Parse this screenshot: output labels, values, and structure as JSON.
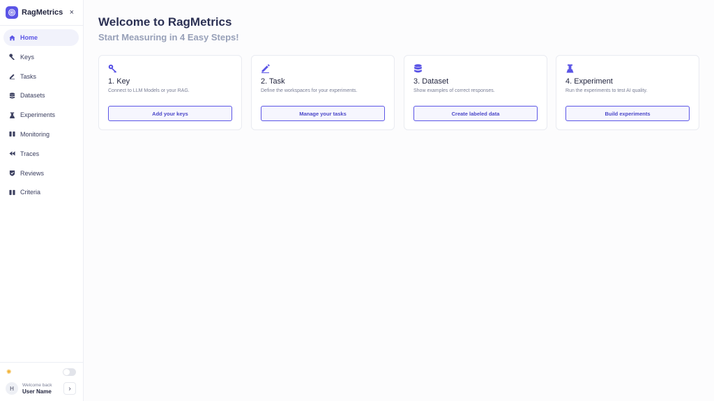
{
  "app": {
    "name": "RagMetrics",
    "close_glyph": "×",
    "accent": "#5b55e6"
  },
  "sidebar": {
    "items": [
      {
        "label": "Home",
        "icon": "home-icon",
        "active": true
      },
      {
        "label": "Keys",
        "icon": "wrench-icon"
      },
      {
        "label": "Tasks",
        "icon": "pencil-icon"
      },
      {
        "label": "Datasets",
        "icon": "database-icon"
      },
      {
        "label": "Experiments",
        "icon": "flask-icon"
      },
      {
        "label": "Monitoring",
        "icon": "monitor-icon"
      },
      {
        "label": "Traces",
        "icon": "rewind-icon"
      },
      {
        "label": "Reviews",
        "icon": "check-shield-icon"
      },
      {
        "label": "Criteria",
        "icon": "columns-icon"
      }
    ],
    "footer": {
      "theme_icon": "sun-icon",
      "user": {
        "initial": "H",
        "welcome": "Welcome back",
        "name": "User Name"
      },
      "expand_glyph": "›"
    }
  },
  "main": {
    "title": "Welcome to RagMetrics",
    "subtitle": "Start Measuring in 4 Easy Steps!",
    "cards": [
      {
        "icon": "key-icon",
        "title": "1. Key",
        "desc": "Connect to LLM Models or your RAG.",
        "button": "Add your keys"
      },
      {
        "icon": "pencil-icon",
        "title": "2. Task",
        "desc": "Define the workspaces for your experiments.",
        "button": "Manage your tasks"
      },
      {
        "icon": "database-icon",
        "title": "3. Dataset",
        "desc": "Show examples of correct responses.",
        "button": "Create labeled data"
      },
      {
        "icon": "flask-icon",
        "title": "4. Experiment",
        "desc": "Run the experiments to test AI quality.",
        "button": "Build experiments"
      }
    ]
  }
}
